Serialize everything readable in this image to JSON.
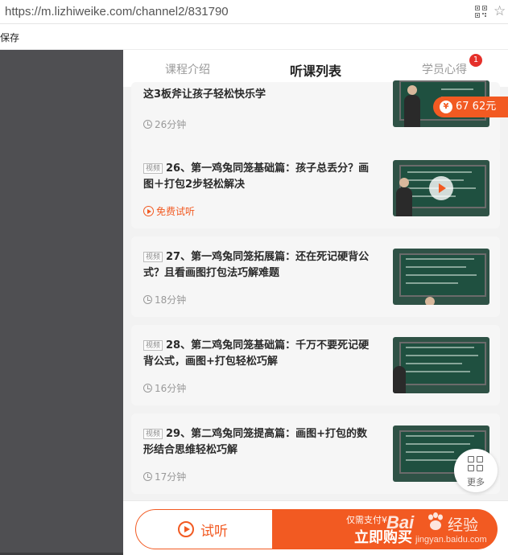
{
  "browser": {
    "url": "https://m.lizhiweike.com/channel2/831790",
    "bookmark_label": "保存"
  },
  "tabs": [
    {
      "label": "课程介绍",
      "active": false
    },
    {
      "label": "听课列表",
      "active": true
    },
    {
      "label": "学员心得",
      "active": false,
      "badge": "1"
    }
  ],
  "coin_float": {
    "label": "67 62元",
    "icon": "coin-icon"
  },
  "lessons": [
    {
      "tag": "",
      "title": "这3板斧让孩子轻松快乐学",
      "meta": "26分钟",
      "meta_type": "duration"
    },
    {
      "tag": "视频",
      "title": "26、第一鸡兔同笼基础篇：孩子总丢分？画图＋打包2步轻松解决",
      "meta": "免费试听",
      "meta_type": "free"
    },
    {
      "tag": "视频",
      "title": "27、第一鸡兔同笼拓展篇：还在死记硬背公式？且看画图打包法巧解难题",
      "meta": "18分钟",
      "meta_type": "duration"
    },
    {
      "tag": "视频",
      "title": "28、第二鸡兔同笼基础篇：千万不要死记硬背公式，画图+打包轻松巧解",
      "meta": "16分钟",
      "meta_type": "duration"
    },
    {
      "tag": "视频",
      "title": "29、第二鸡兔同笼提高篇：画图+打包的数形结合思维轻松巧解",
      "meta": "17分钟",
      "meta_type": "duration"
    }
  ],
  "more_button": {
    "label": "更多",
    "icon": "grid-icon"
  },
  "bottom_bar": {
    "listen_label": "试听",
    "buy_sub": "仅需支付¥",
    "buy_label": "立即购买"
  },
  "watermark": {
    "brand": "Bai",
    "brand2": "经验",
    "site": "jingyan.baidu.com"
  },
  "colors": {
    "accent": "#f25a22",
    "badge": "#e5302a"
  }
}
